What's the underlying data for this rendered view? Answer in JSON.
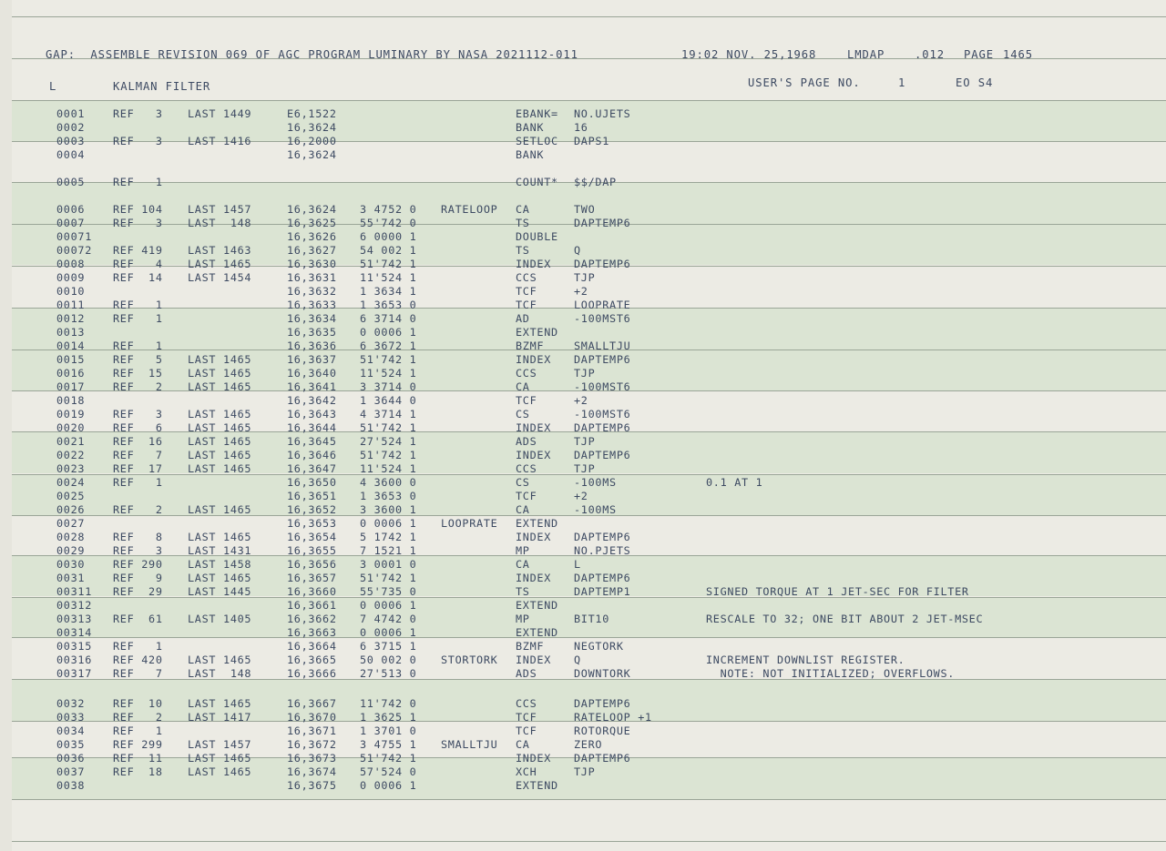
{
  "header": {
    "title": "GAP:  ASSEMBLE REVISION 069 OF AGC PROGRAM LUMINARY BY NASA 2021112-011",
    "timestamp": "19:02 NOV. 25,1968",
    "site": "LMDAP",
    "fraction": ".012",
    "page_label": "PAGE",
    "page_number": "1465",
    "left_marker": "L",
    "section_title": "KALMAN FILTER",
    "users_page_label": "USER'S PAGE NO.",
    "users_page_number": "1",
    "eo_code": "EO S4"
  },
  "rows": [
    {
      "line": "0001",
      "ref": "REF   3",
      "last": "LAST 1449",
      "addr": "E6,1522",
      "word": "",
      "label": "",
      "op": "EBANK=",
      "operand": "NO.UJETS",
      "comment": ""
    },
    {
      "line": "0002",
      "ref": "",
      "last": "",
      "addr": "16,3624",
      "word": "",
      "label": "",
      "op": "BANK",
      "operand": "16",
      "comment": ""
    },
    {
      "line": "0003",
      "ref": "REF   3",
      "last": "LAST 1416",
      "addr": "16,2000",
      "word": "",
      "label": "",
      "op": "SETLOC",
      "operand": "DAPS1",
      "comment": ""
    },
    {
      "line": "0004",
      "ref": "",
      "last": "",
      "addr": "16,3624",
      "word": "",
      "label": "",
      "op": "BANK",
      "operand": "",
      "comment": ""
    },
    {
      "line": "0005",
      "ref": "REF   1",
      "last": "",
      "addr": "",
      "word": "",
      "label": "",
      "op": "COUNT*",
      "operand": "$$/DAP",
      "comment": ""
    },
    {
      "line": "0006",
      "ref": "REF 104",
      "last": "LAST 1457",
      "addr": "16,3624",
      "word": "3 4752 0",
      "label": "RATELOOP",
      "op": "CA",
      "operand": "TWO",
      "comment": ""
    },
    {
      "line": "0007",
      "ref": "REF   3",
      "last": "LAST  148",
      "addr": "16,3625",
      "word": "55'742 0",
      "label": "",
      "op": "TS",
      "operand": "DAPTEMP6",
      "comment": ""
    },
    {
      "line": "00071",
      "ref": "",
      "last": "",
      "addr": "16,3626",
      "word": "6 0000 1",
      "label": "",
      "op": "DOUBLE",
      "operand": "",
      "comment": ""
    },
    {
      "line": "00072",
      "ref": "REF 419",
      "last": "LAST 1463",
      "addr": "16,3627",
      "word": "54 002 1",
      "label": "",
      "op": "TS",
      "operand": "Q",
      "comment": ""
    },
    {
      "line": "0008",
      "ref": "REF   4",
      "last": "LAST 1465",
      "addr": "16,3630",
      "word": "51'742 1",
      "label": "",
      "op": "INDEX",
      "operand": "DAPTEMP6",
      "comment": ""
    },
    {
      "line": "0009",
      "ref": "REF  14",
      "last": "LAST 1454",
      "addr": "16,3631",
      "word": "11'524 1",
      "label": "",
      "op": "CCS",
      "operand": "TJP",
      "comment": ""
    },
    {
      "line": "0010",
      "ref": "",
      "last": "",
      "addr": "16,3632",
      "word": "1 3634 1",
      "label": "",
      "op": "TCF",
      "operand": "+2",
      "comment": ""
    },
    {
      "line": "0011",
      "ref": "REF   1",
      "last": "",
      "addr": "16,3633",
      "word": "1 3653 0",
      "label": "",
      "op": "TCF",
      "operand": "LOOPRATE",
      "comment": ""
    },
    {
      "line": "0012",
      "ref": "REF   1",
      "last": "",
      "addr": "16,3634",
      "word": "6 3714 0",
      "label": "",
      "op": "AD",
      "operand": "-100MST6",
      "comment": ""
    },
    {
      "line": "0013",
      "ref": "",
      "last": "",
      "addr": "16,3635",
      "word": "0 0006 1",
      "label": "",
      "op": "EXTEND",
      "operand": "",
      "comment": ""
    },
    {
      "line": "0014",
      "ref": "REF   1",
      "last": "",
      "addr": "16,3636",
      "word": "6 3672 1",
      "label": "",
      "op": "BZMF",
      "operand": "SMALLTJU",
      "comment": ""
    },
    {
      "line": "0015",
      "ref": "REF   5",
      "last": "LAST 1465",
      "addr": "16,3637",
      "word": "51'742 1",
      "label": "",
      "op": "INDEX",
      "operand": "DAPTEMP6",
      "comment": ""
    },
    {
      "line": "0016",
      "ref": "REF  15",
      "last": "LAST 1465",
      "addr": "16,3640",
      "word": "11'524 1",
      "label": "",
      "op": "CCS",
      "operand": "TJP",
      "comment": ""
    },
    {
      "line": "0017",
      "ref": "REF   2",
      "last": "LAST 1465",
      "addr": "16,3641",
      "word": "3 3714 0",
      "label": "",
      "op": "CA",
      "operand": "-100MST6",
      "comment": ""
    },
    {
      "line": "0018",
      "ref": "",
      "last": "",
      "addr": "16,3642",
      "word": "1 3644 0",
      "label": "",
      "op": "TCF",
      "operand": "+2",
      "comment": ""
    },
    {
      "line": "0019",
      "ref": "REF   3",
      "last": "LAST 1465",
      "addr": "16,3643",
      "word": "4 3714 1",
      "label": "",
      "op": "CS",
      "operand": "-100MST6",
      "comment": ""
    },
    {
      "line": "0020",
      "ref": "REF   6",
      "last": "LAST 1465",
      "addr": "16,3644",
      "word": "51'742 1",
      "label": "",
      "op": "INDEX",
      "operand": "DAPTEMP6",
      "comment": ""
    },
    {
      "line": "0021",
      "ref": "REF  16",
      "last": "LAST 1465",
      "addr": "16,3645",
      "word": "27'524 1",
      "label": "",
      "op": "ADS",
      "operand": "TJP",
      "comment": ""
    },
    {
      "line": "0022",
      "ref": "REF   7",
      "last": "LAST 1465",
      "addr": "16,3646",
      "word": "51'742 1",
      "label": "",
      "op": "INDEX",
      "operand": "DAPTEMP6",
      "comment": ""
    },
    {
      "line": "0023",
      "ref": "REF  17",
      "last": "LAST 1465",
      "addr": "16,3647",
      "word": "11'524 1",
      "label": "",
      "op": "CCS",
      "operand": "TJP",
      "comment": ""
    },
    {
      "line": "0024",
      "ref": "REF   1",
      "last": "",
      "addr": "16,3650",
      "word": "4 3600 0",
      "label": "",
      "op": "CS",
      "operand": "-100MS",
      "comment": "0.1 AT 1"
    },
    {
      "line": "0025",
      "ref": "",
      "last": "",
      "addr": "16,3651",
      "word": "1 3653 0",
      "label": "",
      "op": "TCF",
      "operand": "+2",
      "comment": ""
    },
    {
      "line": "0026",
      "ref": "REF   2",
      "last": "LAST 1465",
      "addr": "16,3652",
      "word": "3 3600 1",
      "label": "",
      "op": "CA",
      "operand": "-100MS",
      "comment": ""
    },
    {
      "line": "0027",
      "ref": "",
      "last": "",
      "addr": "16,3653",
      "word": "0 0006 1",
      "label": "LOOPRATE",
      "op": "EXTEND",
      "operand": "",
      "comment": ""
    },
    {
      "line": "0028",
      "ref": "REF   8",
      "last": "LAST 1465",
      "addr": "16,3654",
      "word": "5 1742 1",
      "label": "",
      "op": "INDEX",
      "operand": "DAPTEMP6",
      "comment": ""
    },
    {
      "line": "0029",
      "ref": "REF   3",
      "last": "LAST 1431",
      "addr": "16,3655",
      "word": "7 1521 1",
      "label": "",
      "op": "MP",
      "operand": "NO.PJETS",
      "comment": ""
    },
    {
      "line": "0030",
      "ref": "REF 290",
      "last": "LAST 1458",
      "addr": "16,3656",
      "word": "3 0001 0",
      "label": "",
      "op": "CA",
      "operand": "L",
      "comment": ""
    },
    {
      "line": "0031",
      "ref": "REF   9",
      "last": "LAST 1465",
      "addr": "16,3657",
      "word": "51'742 1",
      "label": "",
      "op": "INDEX",
      "operand": "DAPTEMP6",
      "comment": ""
    },
    {
      "line": "00311",
      "ref": "REF  29",
      "last": "LAST 1445",
      "addr": "16,3660",
      "word": "55'735 0",
      "label": "",
      "op": "TS",
      "operand": "DAPTEMP1",
      "comment": "SIGNED TORQUE AT 1 JET-SEC FOR FILTER"
    },
    {
      "line": "00312",
      "ref": "",
      "last": "",
      "addr": "16,3661",
      "word": "0 0006 1",
      "label": "",
      "op": "EXTEND",
      "operand": "",
      "comment": ""
    },
    {
      "line": "00313",
      "ref": "REF  61",
      "last": "LAST 1405",
      "addr": "16,3662",
      "word": "7 4742 0",
      "label": "",
      "op": "MP",
      "operand": "BIT10",
      "comment": "RESCALE TO 32; ONE BIT ABOUT 2 JET-MSEC"
    },
    {
      "line": "00314",
      "ref": "",
      "last": "",
      "addr": "16,3663",
      "word": "0 0006 1",
      "label": "",
      "op": "EXTEND",
      "operand": "",
      "comment": ""
    },
    {
      "line": "00315",
      "ref": "REF   1",
      "last": "",
      "addr": "16,3664",
      "word": "6 3715 1",
      "label": "",
      "op": "BZMF",
      "operand": "NEGTORK",
      "comment": ""
    },
    {
      "line": "00316",
      "ref": "REF 420",
      "last": "LAST 1465",
      "addr": "16,3665",
      "word": "50 002 0",
      "label": "STORTORK",
      "op": "INDEX",
      "operand": "Q",
      "comment": "INCREMENT DOWNLIST REGISTER."
    },
    {
      "line": "00317",
      "ref": "REF   7",
      "last": "LAST  148",
      "addr": "16,3666",
      "word": "27'513 0",
      "label": "",
      "op": "ADS",
      "operand": "DOWNTORK",
      "comment": "  NOTE: NOT INITIALIZED; OVERFLOWS."
    },
    {
      "line": "0032",
      "ref": "REF  10",
      "last": "LAST 1465",
      "addr": "16,3667",
      "word": "11'742 0",
      "label": "",
      "op": "CCS",
      "operand": "DAPTEMP6",
      "comment": ""
    },
    {
      "line": "0033",
      "ref": "REF   2",
      "last": "LAST 1417",
      "addr": "16,3670",
      "word": "1 3625 1",
      "label": "",
      "op": "TCF",
      "operand": "RATELOOP +1",
      "comment": ""
    },
    {
      "line": "0034",
      "ref": "REF   1",
      "last": "",
      "addr": "16,3671",
      "word": "1 3701 0",
      "label": "",
      "op": "TCF",
      "operand": "ROTORQUE",
      "comment": ""
    },
    {
      "line": "0035",
      "ref": "REF 299",
      "last": "LAST 1457",
      "addr": "16,3672",
      "word": "3 4755 1",
      "label": "SMALLTJU",
      "op": "CA",
      "operand": "ZERO",
      "comment": ""
    },
    {
      "line": "0036",
      "ref": "REF  11",
      "last": "LAST 1465",
      "addr": "16,3673",
      "word": "51'742 1",
      "label": "",
      "op": "INDEX",
      "operand": "DAPTEMP6",
      "comment": ""
    },
    {
      "line": "0037",
      "ref": "REF  18",
      "last": "LAST 1465",
      "addr": "16,3674",
      "word": "57'524 0",
      "label": "",
      "op": "XCH",
      "operand": "TJP",
      "comment": ""
    },
    {
      "line": "0038",
      "ref": "",
      "last": "",
      "addr": "16,3675",
      "word": "0 0006 1",
      "label": "",
      "op": "EXTEND",
      "operand": "",
      "comment": ""
    }
  ]
}
